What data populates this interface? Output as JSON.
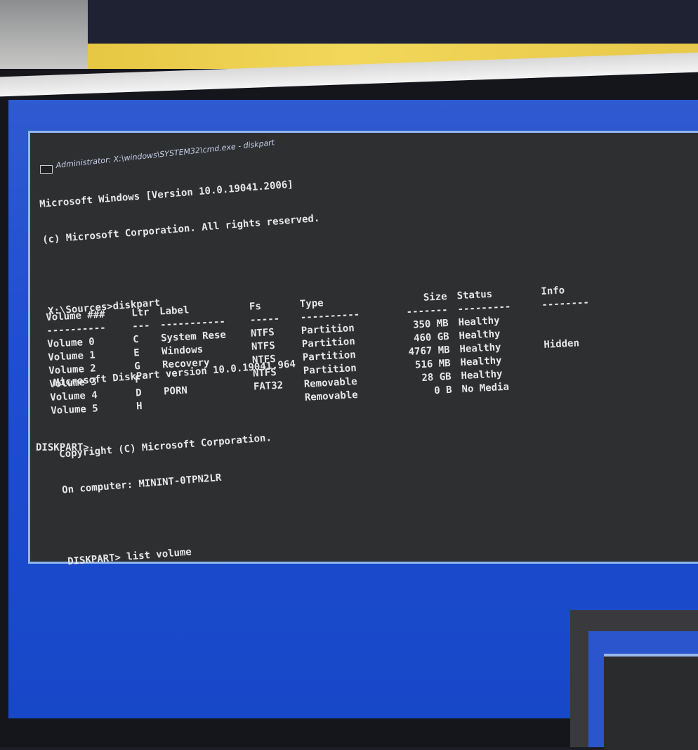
{
  "window": {
    "title": "Administrator: X:\\windows\\SYSTEM32\\cmd.exe - diskpart"
  },
  "console": {
    "lines": [
      "Microsoft Windows [Version 10.0.19041.2006]",
      "(c) Microsoft Corporation. All rights reserved.",
      "",
      "X:\\Sources>diskpart",
      "",
      "Microsoft DiskPart version 10.0.19041.964",
      "",
      "Copyright (C) Microsoft Corporation.",
      "On computer: MININT-0TPN2LR",
      "",
      "DISKPART> list volume"
    ],
    "final_prompt": "DISKPART>"
  },
  "volume_table": {
    "headers": [
      "Volume ###",
      "Ltr",
      "Label",
      "Fs",
      "Type",
      "Size",
      "Status",
      "Info"
    ],
    "separators": [
      "----------",
      "---",
      "-----------",
      "-----",
      "----------",
      "-------",
      "---------",
      "--------"
    ],
    "rows": [
      {
        "volume": "Volume 0",
        "ltr": "C",
        "label": "System Rese",
        "fs": "NTFS",
        "type": "Partition",
        "size": "350 MB",
        "status": "Healthy",
        "info": ""
      },
      {
        "volume": "Volume 1",
        "ltr": "E",
        "label": "Windows",
        "fs": "NTFS",
        "type": "Partition",
        "size": "460 GB",
        "status": "Healthy",
        "info": ""
      },
      {
        "volume": "Volume 2",
        "ltr": "G",
        "label": "Recovery",
        "fs": "NTFS",
        "type": "Partition",
        "size": "4767 MB",
        "status": "Healthy",
        "info": "Hidden"
      },
      {
        "volume": "Volume 3",
        "ltr": "F",
        "label": "",
        "fs": "NTFS",
        "type": "Partition",
        "size": "516 MB",
        "status": "Healthy",
        "info": ""
      },
      {
        "volume": "Volume 4",
        "ltr": "D",
        "label": "PORN",
        "fs": "FAT32",
        "type": "Removable",
        "size": "28 GB",
        "status": "Healthy",
        "info": ""
      },
      {
        "volume": "Volume 5",
        "ltr": "H",
        "label": "",
        "fs": "",
        "type": "Removable",
        "size": "0 B",
        "status": "No Media",
        "info": ""
      }
    ]
  },
  "colors": {
    "desktop": "#1f4ed0",
    "console_bg": "#2e2f31",
    "console_text": "#e6e6e6",
    "window_border": "#8fb6f0"
  }
}
